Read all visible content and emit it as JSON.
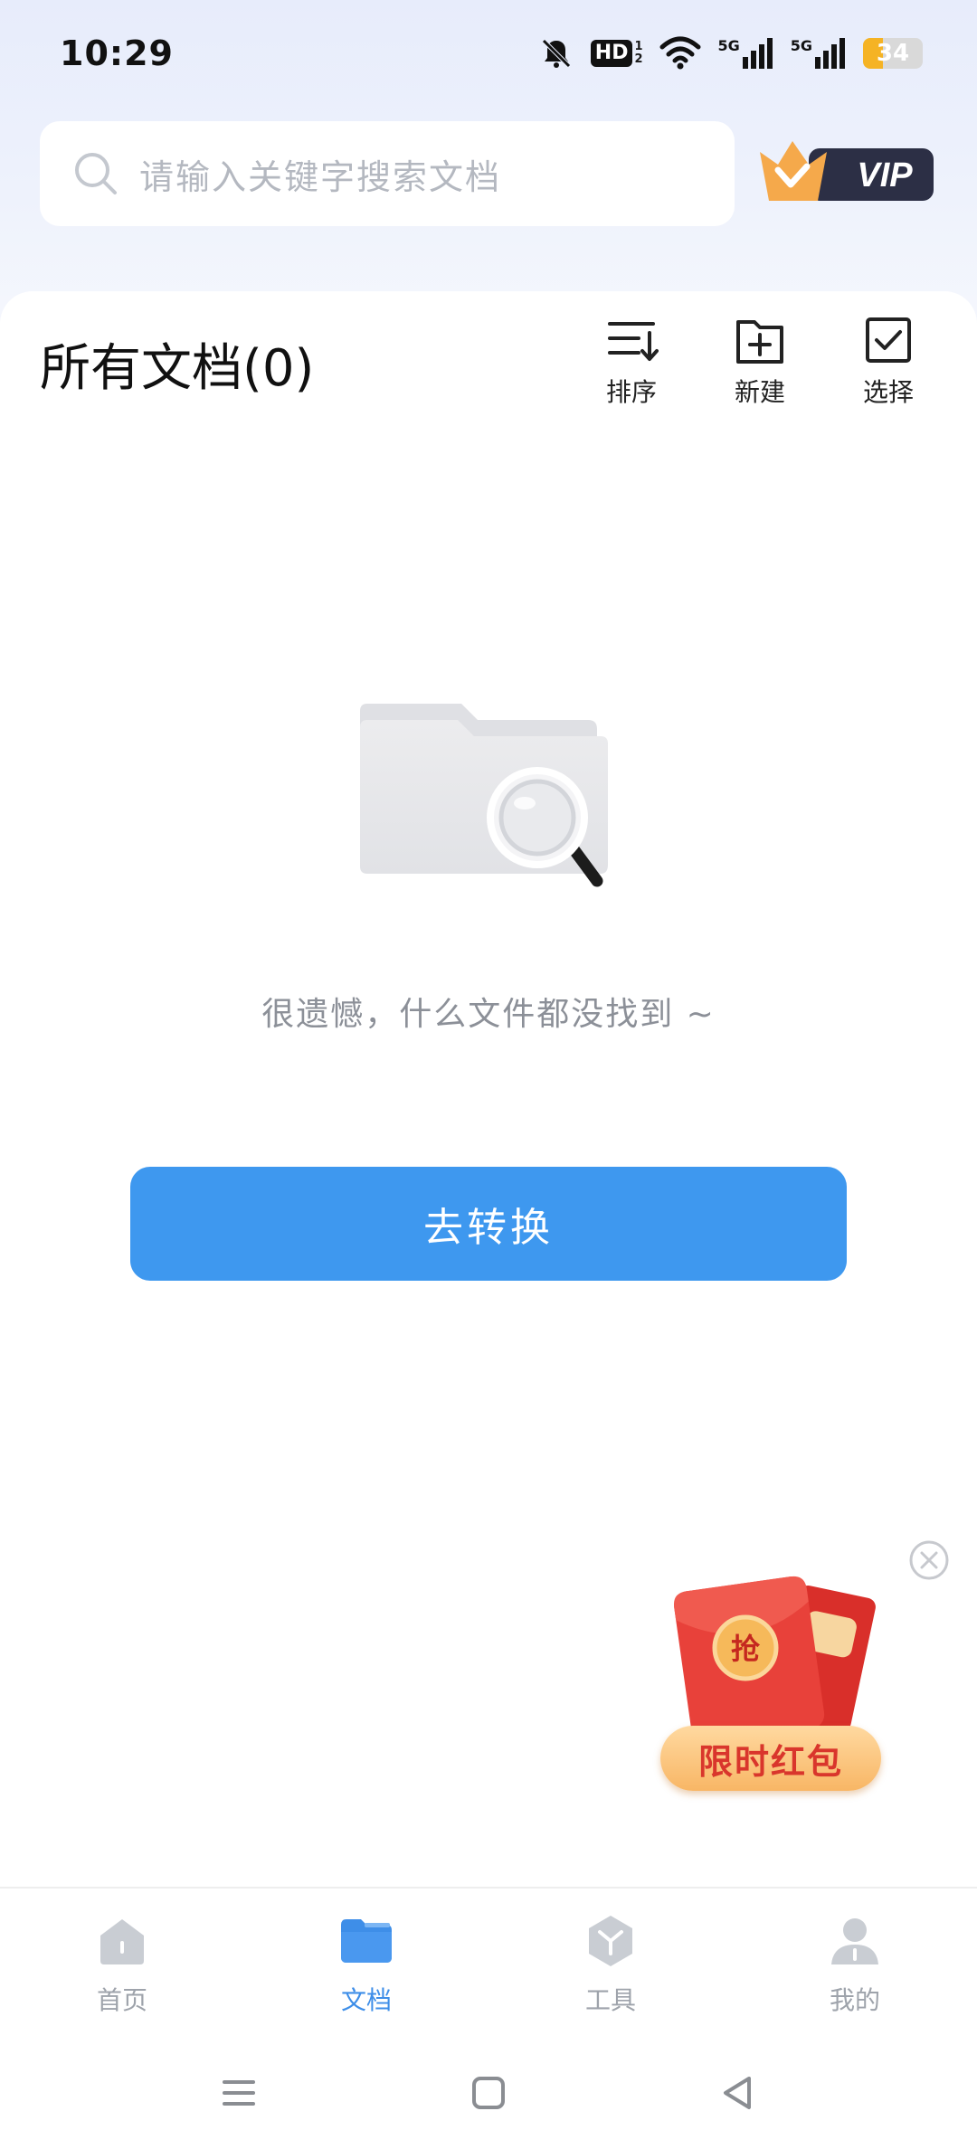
{
  "status_bar": {
    "time": "10:29",
    "hd_label": "HD",
    "hd_sub": "1 2",
    "signal1_label": "5G",
    "signal2_label": "5G",
    "battery_level": "34",
    "icons": [
      "bell-muted-icon",
      "hd-icon",
      "wifi-icon",
      "signal-5g-icon",
      "signal-5g-icon",
      "battery-icon"
    ]
  },
  "search": {
    "placeholder": "请输入关键字搜索文档",
    "icon": "search-icon"
  },
  "vip": {
    "label": "VIP",
    "icon": "crown-icon"
  },
  "header": {
    "title": "所有文档(0)",
    "actions": [
      {
        "label": "排序",
        "icon": "sort-icon"
      },
      {
        "label": "新建",
        "icon": "new-folder-icon"
      },
      {
        "label": "选择",
        "icon": "checkbox-icon"
      }
    ]
  },
  "empty_state": {
    "icon": "folder-search-icon",
    "message": "很遗憾，什么文件都没找到 ~",
    "button_label": "去转换"
  },
  "promo": {
    "badge": "抢",
    "label": "限时红包",
    "close_icon": "close-circle-icon"
  },
  "bottom_nav": {
    "items": [
      {
        "label": "首页",
        "icon": "home-icon",
        "active": false
      },
      {
        "label": "文档",
        "icon": "folder-icon",
        "active": true
      },
      {
        "label": "工具",
        "icon": "tools-icon",
        "active": false
      },
      {
        "label": "我的",
        "icon": "profile-icon",
        "active": false
      }
    ]
  },
  "system_nav": {
    "icons": [
      "menu-icon",
      "home-square-icon",
      "back-icon"
    ]
  },
  "colors": {
    "accent": "#3e98ef",
    "active_tab": "#3e8ee8",
    "inactive": "#9ea3ab",
    "promo_red": "#d9362c"
  }
}
